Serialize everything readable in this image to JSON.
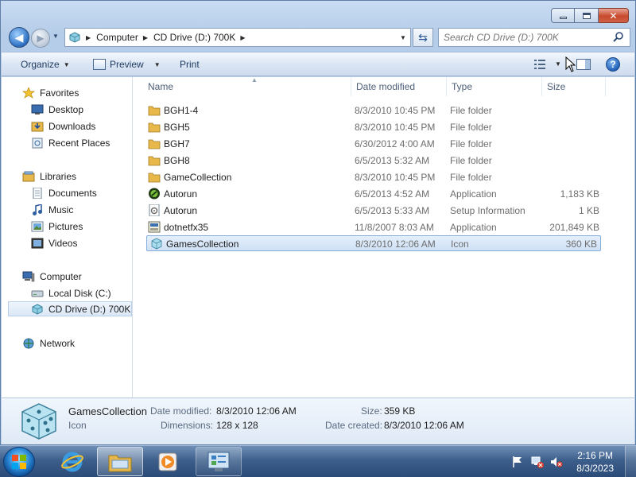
{
  "address": {
    "breadcrumbs": [
      "Computer",
      "CD Drive (D:) 700K"
    ]
  },
  "search": {
    "placeholder": "Search CD Drive (D:) 700K"
  },
  "toolbar": {
    "organize_label": "Organize",
    "preview_label": "Preview",
    "print_label": "Print"
  },
  "nav": {
    "favorites": "Favorites",
    "desktop": "Desktop",
    "downloads": "Downloads",
    "recent": "Recent Places",
    "libraries": "Libraries",
    "documents": "Documents",
    "music": "Music",
    "pictures": "Pictures",
    "videos": "Videos",
    "computer": "Computer",
    "local_disk": "Local Disk (C:)",
    "cd_drive": "CD Drive (D:) 700K",
    "network": "Network"
  },
  "columns": {
    "name": "Name",
    "date": "Date modified",
    "type": "Type",
    "size": "Size"
  },
  "files": [
    {
      "name": "BGH1-4",
      "date": "8/3/2010 10:45 PM",
      "type": "File folder",
      "size": "",
      "icon": "folder-icon"
    },
    {
      "name": "BGH5",
      "date": "8/3/2010 10:45 PM",
      "type": "File folder",
      "size": "",
      "icon": "folder-icon"
    },
    {
      "name": "BGH7",
      "date": "6/30/2012 4:00 AM",
      "type": "File folder",
      "size": "",
      "icon": "folder-icon"
    },
    {
      "name": "BGH8",
      "date": "6/5/2013 5:32 AM",
      "type": "File folder",
      "size": "",
      "icon": "folder-icon"
    },
    {
      "name": "GameCollection",
      "date": "8/3/2010 10:45 PM",
      "type": "File folder",
      "size": "",
      "icon": "folder-icon"
    },
    {
      "name": "Autorun",
      "date": "6/5/2013 4:52 AM",
      "type": "Application",
      "size": "1,183 KB",
      "icon": "autorun-app-icon"
    },
    {
      "name": "Autorun",
      "date": "6/5/2013 5:33 AM",
      "type": "Setup Information",
      "size": "1 KB",
      "icon": "setup-info-icon"
    },
    {
      "name": "dotnetfx35",
      "date": "11/8/2007 8:03 AM",
      "type": "Application",
      "size": "201,849 KB",
      "icon": "installer-icon"
    },
    {
      "name": "GamesCollection",
      "date": "8/3/2010 12:06 AM",
      "type": "Icon",
      "size": "360 KB",
      "icon": "dice-icon"
    }
  ],
  "details": {
    "name": "GamesCollection",
    "type": "Icon",
    "date_modified_label": "Date modified:",
    "date_modified": "8/3/2010 12:06 AM",
    "dimensions_label": "Dimensions:",
    "dimensions": "128 x 128",
    "size_label": "Size:",
    "size": "359 KB",
    "date_created_label": "Date created:",
    "date_created": "8/3/2010 12:06 AM"
  },
  "taskbar": {
    "time": "2:16 PM",
    "date": "8/3/2023"
  },
  "colors": {
    "selection_border": "#84acdd",
    "folder": "#e8b94a",
    "taskbar": "#3d5f8b"
  }
}
